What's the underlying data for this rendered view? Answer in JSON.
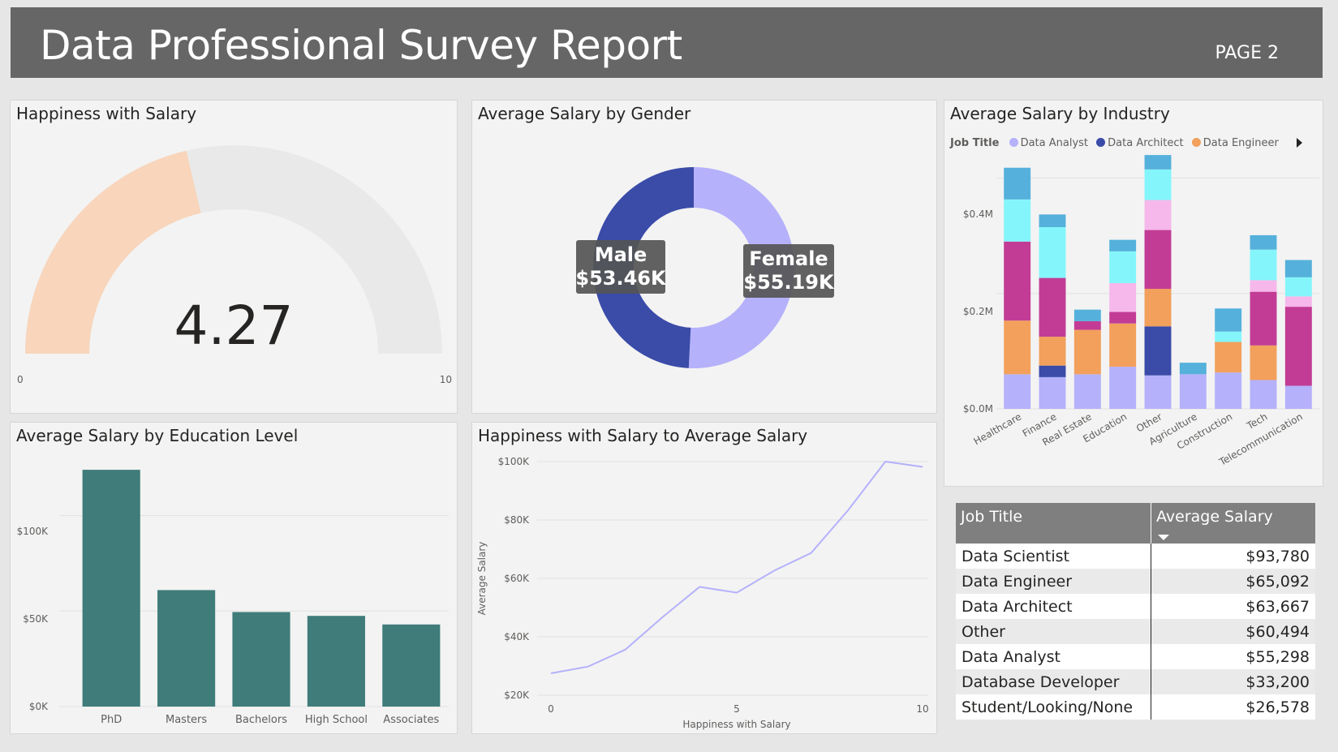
{
  "header": {
    "title": "Data Professional Survey Report",
    "page": "PAGE 2"
  },
  "gauge": {
    "title": "Happiness with Salary",
    "value": 4.27,
    "value_label": "4.27",
    "min": 0,
    "max": 10,
    "min_label": "0",
    "max_label": "10",
    "fill_color": "#f8d5bb",
    "track_color": "#e9e9e9"
  },
  "donut": {
    "title": "Average Salary by Gender",
    "slices": [
      {
        "name": "Female",
        "value": 55190,
        "label_name": "Female",
        "label_value": "$55.19K",
        "color": "#b5b1fb"
      },
      {
        "name": "Male",
        "value": 53460,
        "label_name": "Male",
        "label_value": "$53.46K",
        "color": "#3a4ba8"
      }
    ]
  },
  "industry": {
    "title": "Average Salary by Industry",
    "legend_title": "Job Title",
    "legend": [
      {
        "name": "Data Analyst",
        "color": "#b5b1fb"
      },
      {
        "name": "Data Architect",
        "color": "#3a4ba8"
      },
      {
        "name": "Data Engineer",
        "color": "#f2a05b"
      }
    ],
    "y_ticks": [
      "$0.4M",
      "$0.2M",
      "$0.0M"
    ]
  },
  "education": {
    "title": "Average Salary by Education Level",
    "y_ticks": [
      "$100K",
      "$50K",
      "$0K"
    ]
  },
  "line": {
    "title": "Happiness with Salary to Average Salary",
    "xlabel": "Happiness with Salary",
    "ylabel": "Average Salary",
    "y_ticks": [
      "$100K",
      "$80K",
      "$60K",
      "$40K",
      "$20K"
    ],
    "x_ticks": [
      "0",
      "5",
      "10"
    ]
  },
  "table": {
    "col1": "Job Title",
    "col2": "Average Salary",
    "rows": [
      {
        "title": "Data Scientist",
        "salary": "$93,780"
      },
      {
        "title": "Data Engineer",
        "salary": "$65,092"
      },
      {
        "title": "Data Architect",
        "salary": "$63,667"
      },
      {
        "title": "Other",
        "salary": "$60,494"
      },
      {
        "title": "Data Analyst",
        "salary": "$55,298"
      },
      {
        "title": "Database Developer",
        "salary": "$33,200"
      },
      {
        "title": "Student/Looking/None",
        "salary": "$26,578"
      }
    ]
  },
  "chart_data": [
    {
      "type": "bar",
      "title": "Average Salary by Education Level",
      "categories": [
        "PhD",
        "Masters",
        "Bachelors",
        "High School",
        "Associates"
      ],
      "values": [
        124000,
        61000,
        49500,
        47500,
        43000
      ],
      "ylim": [
        0,
        130000
      ],
      "color": "#3f7c7a"
    },
    {
      "type": "line",
      "title": "Happiness with Salary to Average Salary",
      "xlabel": "Happiness with Salary",
      "ylabel": "Average Salary",
      "x": [
        0,
        1,
        2,
        3,
        4,
        5,
        6,
        7,
        8,
        9,
        10
      ],
      "values": [
        27500,
        29800,
        35600,
        46700,
        57100,
        55100,
        62600,
        68700,
        83400,
        100000,
        98200
      ],
      "ylim": [
        20000,
        100000
      ],
      "xlim": [
        0,
        10
      ],
      "color": "#b5b1fb"
    },
    {
      "type": "bar",
      "stacked": true,
      "title": "Average Salary by Industry",
      "categories": [
        "Healthcare",
        "Finance",
        "Real Estate",
        "Education",
        "Other",
        "Agriculture",
        "Construction",
        "Tech",
        "Telecommunication"
      ],
      "ylim": [
        0,
        0.45
      ],
      "series": [
        {
          "name": "Data Analyst",
          "color": "#b5b1fb",
          "values": [
            0.06,
            0.055,
            0.06,
            0.073,
            0.058,
            0.06,
            0.063,
            0.05,
            0.04
          ]
        },
        {
          "name": "Data Architect",
          "color": "#3a4ba8",
          "values": [
            0,
            0.02,
            0,
            0,
            0.085,
            0,
            0,
            0,
            0
          ]
        },
        {
          "name": "Data Engineer",
          "color": "#f2a05b",
          "values": [
            0.093,
            0.05,
            0.077,
            0.075,
            0.065,
            0,
            0.053,
            0.06,
            0
          ]
        },
        {
          "color": "#c23c95",
          "values": [
            0.137,
            0.102,
            0.015,
            0.02,
            0.102,
            0,
            0,
            0.093,
            0.137
          ]
        },
        {
          "color": "#f6b8ea",
          "values": [
            0,
            0,
            0,
            0.05,
            0.052,
            0,
            0,
            0.02,
            0.018
          ]
        },
        {
          "color": "#84f6fb",
          "values": [
            0.073,
            0.088,
            0,
            0.055,
            0.053,
            0,
            0.018,
            0.053,
            0.033
          ]
        },
        {
          "color": "#55b1db",
          "values": [
            0.055,
            0.022,
            0.02,
            0.02,
            0.025,
            0.02,
            0.04,
            0.025,
            0.03
          ]
        }
      ]
    }
  ]
}
